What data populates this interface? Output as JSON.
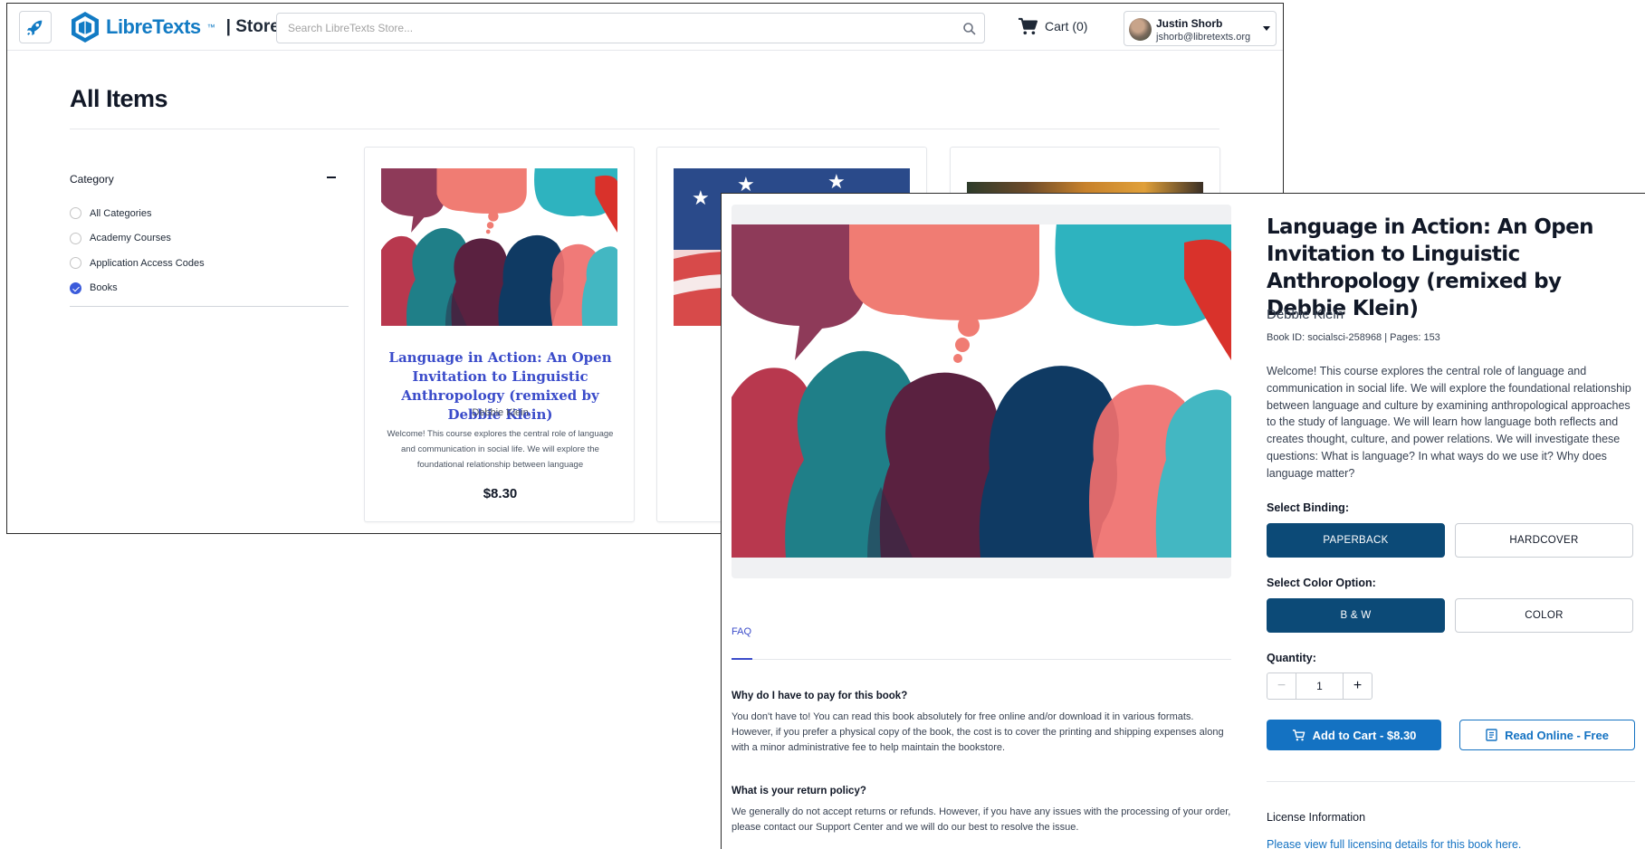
{
  "colors": {
    "brand": "#127bc4",
    "accent_link": "#3b4cca",
    "primary_button": "#1472c2",
    "selected_option": "#0c4a77",
    "checked_radio": "#3b5bdb"
  },
  "store": {
    "header": {
      "logo_icon": "rocket-icon",
      "brand_name": "LibreTexts",
      "brand_tm": "™",
      "brand_suffix": "| Store",
      "search_placeholder": "Search LibreTexts Store...",
      "search_icon": "search-icon",
      "cart_label": "Cart (0)",
      "cart_icon": "cart-icon",
      "user_name": "Justin Shorb",
      "user_email": "jshorb@libretexts.org"
    },
    "page_title": "All Items",
    "filters": {
      "title": "Category",
      "items": [
        {
          "label": "All Categories",
          "checked": false
        },
        {
          "label": "Academy Courses",
          "checked": false
        },
        {
          "label": "Application Access Codes",
          "checked": false
        },
        {
          "label": "Books",
          "checked": true
        }
      ]
    },
    "cards": [
      {
        "title": "Language in Action: An Open Invitation to Linguistic Anthropology (remixed by Debbie Klein)",
        "author": "Debbie Klein",
        "description": "Welcome! This course explores the central role of language and communication in social life. We will explore the foundational relationship between language",
        "price": "$8.30"
      }
    ]
  },
  "product": {
    "title": "Language in Action: An Open Invitation to Linguistic Anthropology (remixed by Debbie Klein)",
    "author": "Debbie Klein",
    "meta": "Book ID: socialsci-258968 | Pages: 153",
    "description": "Welcome! This course explores the central role of language and communication in social life. We will explore the foundational relationship between language and culture by examining anthropological approaches to the study of language. We will learn how language both reflects and creates thought, culture, and power relations. We will investigate these questions: What is language? In what ways do we use it? Why does language matter?",
    "binding_label": "Select Binding:",
    "binding_options": [
      {
        "label": "PAPERBACK",
        "selected": true
      },
      {
        "label": "HARDCOVER",
        "selected": false
      }
    ],
    "color_label": "Select Color Option:",
    "color_options": [
      {
        "label": "B & W",
        "selected": true
      },
      {
        "label": "COLOR",
        "selected": false
      }
    ],
    "quantity_label": "Quantity:",
    "quantity_value": "1",
    "add_to_cart_label": "Add to Cart - $8.30",
    "read_online_label": "Read Online - Free",
    "license_label": "License Information",
    "license_link": "Please view full licensing details for this book here.",
    "faq_tab": "FAQ",
    "faq": [
      {
        "q": "Why do I have to pay for this book?",
        "a": "You don't have to! You can read this book absolutely for free online and/or download it in various formats. However, if you prefer a physical copy of the book, the cost is to cover the printing and shipping expenses along with a minor administrative fee to help maintain the bookstore."
      },
      {
        "q": "What is your return policy?",
        "a": "We generally do not accept returns or refunds. However, if you have any issues with the processing of your order, please contact our Support Center and we will do our best to resolve the issue."
      }
    ]
  }
}
